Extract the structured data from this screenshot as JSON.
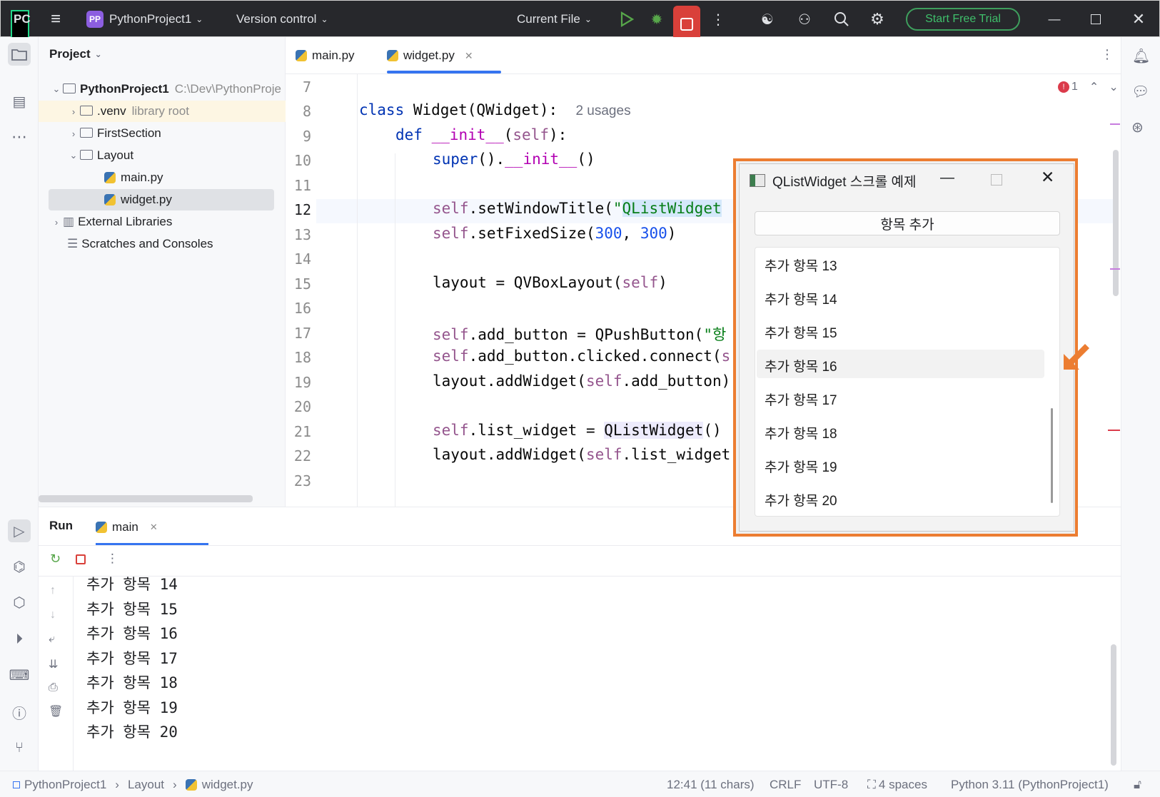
{
  "titlebar": {
    "logo": "PC",
    "project_badge": "PP",
    "project_name": "PythonProject1",
    "vcs": "Version control",
    "run_config": "Current File",
    "trial": "Start Free Trial"
  },
  "project_panel": {
    "header": "Project",
    "tree": [
      {
        "label": "PythonProject1",
        "path": "C:\\Dev\\PythonProje",
        "level": 0,
        "type": "folder",
        "open": true
      },
      {
        "label": ".venv",
        "hint": "library root",
        "level": 1,
        "type": "folder",
        "open": false
      },
      {
        "label": "FirstSection",
        "level": 1,
        "type": "folder",
        "open": false
      },
      {
        "label": "Layout",
        "level": 1,
        "type": "folder",
        "open": true
      },
      {
        "label": "main.py",
        "level": 2,
        "type": "py"
      },
      {
        "label": "widget.py",
        "level": 2,
        "type": "py",
        "selected": true
      },
      {
        "label": "External Libraries",
        "level": 0,
        "type": "lib"
      },
      {
        "label": "Scratches and Consoles",
        "level": 0,
        "type": "scratch"
      }
    ]
  },
  "editor": {
    "tabs": [
      {
        "label": "main.py",
        "active": false
      },
      {
        "label": "widget.py",
        "active": true
      }
    ],
    "error_count": "1",
    "line_numbers": [
      "7",
      "8",
      "9",
      "10",
      "11",
      "12",
      "13",
      "14",
      "15",
      "16",
      "17",
      "18",
      "19",
      "20",
      "21",
      "22",
      "23"
    ],
    "code": {
      "l8_a": "class ",
      "l8_b": "Widget(QWidget):",
      "l8_hint": "2 usages",
      "l9_a": "def ",
      "l9_b": "__init__",
      "l9_c": "(",
      "l9_d": "self",
      "l9_e": "):",
      "l10_a": "super",
      "l10_b": "().",
      "l10_c": "__init__",
      "l10_d": "()",
      "l12_a": "self",
      "l12_b": ".setWindowTitle(",
      "l12_c": "\"",
      "l12_d": "QListWidget",
      "l13_a": "self",
      "l13_b": ".setFixedSize(",
      "l13_c": "300",
      "l13_d": ", ",
      "l13_e": "300",
      "l13_f": ")",
      "l15_a": "layout = QVBoxLayout(",
      "l15_b": "self",
      "l15_c": ")",
      "l17_a": "self",
      "l17_b": ".add_button = QPushButton(",
      "l17_c": "\"항",
      "l18_a": "self",
      "l18_b": ".add_button.clicked.connect(",
      "l18_c": "s",
      "l19_a": "layout.addWidget(",
      "l19_b": "self",
      "l19_c": ".add_button)",
      "l21_a": "self",
      "l21_b": ".list_widget = ",
      "l21_c": "QListWidget",
      "l21_d": "()",
      "l22_a": "layout.addWidget(",
      "l22_b": "self",
      "l22_c": ".list_widget"
    }
  },
  "run_panel": {
    "title": "Run",
    "tab": "main",
    "output": [
      "추가 항목 14",
      "추가 항목 15",
      "추가 항목 16",
      "추가 항목 17",
      "추가 항목 18",
      "추가 항목 19",
      "추가 항목 20"
    ]
  },
  "qt_window": {
    "title": "QListWidget 스크롤 예제",
    "button": "항목 추가",
    "items": [
      "추가 항목 13",
      "추가 항목 14",
      "추가 항목 15",
      "추가 항목 16",
      "추가 항목 17",
      "추가 항목 18",
      "추가 항목 19",
      "추가 항목 20"
    ],
    "hovered_index": 3
  },
  "statusbar": {
    "breadcrumb": [
      "PythonProject1",
      "Layout",
      "widget.py"
    ],
    "position": "12:41 (11 chars)",
    "line_sep": "CRLF",
    "encoding": "UTF-8",
    "indent": "4 spaces",
    "interpreter": "Python 3.11 (PythonProject1)"
  },
  "colors": {
    "highlight_frame": "#ec7d31",
    "titlebar_bg": "#27282c",
    "stop_button": "#d9403a",
    "trial_green": "#3e9e5d"
  }
}
